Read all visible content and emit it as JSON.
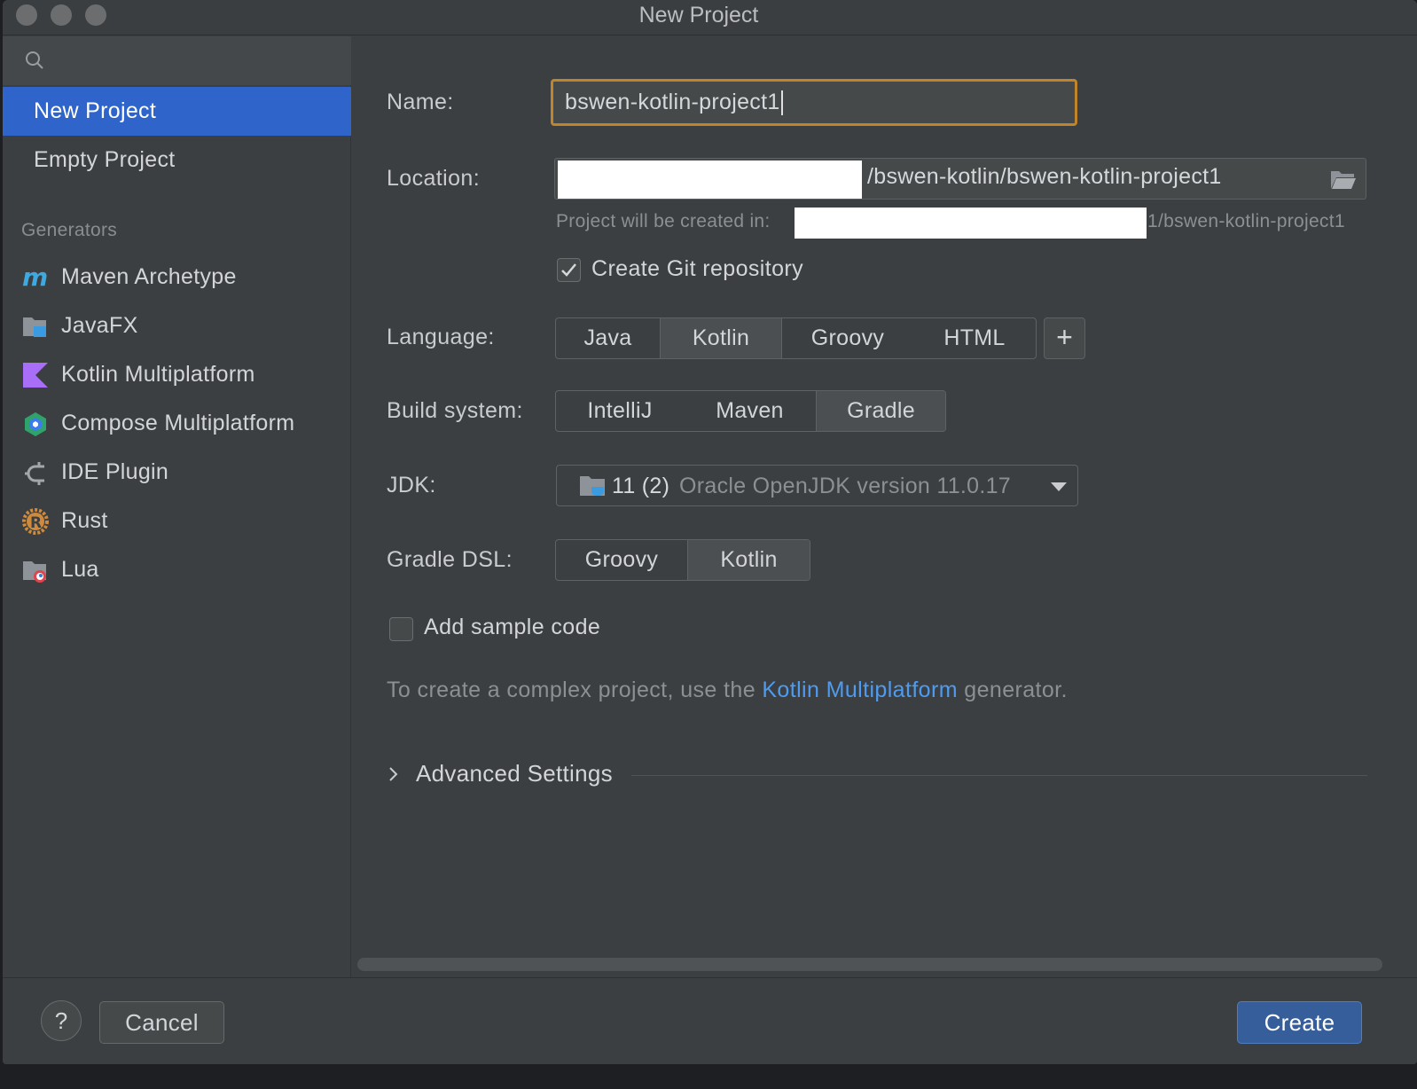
{
  "window": {
    "title": "New Project"
  },
  "sidebar": {
    "search_placeholder": "",
    "project_types": [
      {
        "label": "New Project",
        "selected": true
      },
      {
        "label": "Empty Project",
        "selected": false
      }
    ],
    "generators_header": "Generators",
    "generators": [
      {
        "label": "Maven Archetype",
        "icon": "maven-icon"
      },
      {
        "label": "JavaFX",
        "icon": "javafx-icon"
      },
      {
        "label": "Kotlin Multiplatform",
        "icon": "kotlin-icon"
      },
      {
        "label": "Compose Multiplatform",
        "icon": "compose-icon"
      },
      {
        "label": "IDE Plugin",
        "icon": "plugin-icon"
      },
      {
        "label": "Rust",
        "icon": "rust-icon"
      },
      {
        "label": "Lua",
        "icon": "lua-icon"
      }
    ]
  },
  "form": {
    "name_label": "Name:",
    "name_value": "bswen-kotlin-project1",
    "location_label": "Location:",
    "location_value": "/bswen-kotlin/bswen-kotlin-project1",
    "project_hint_prefix": "Project will be created in:",
    "project_hint_suffix": "1/bswen-kotlin-project1",
    "git_checkbox_label": "Create Git repository",
    "git_checked": true,
    "language_label": "Language:",
    "languages": [
      "Java",
      "Kotlin",
      "Groovy",
      "HTML"
    ],
    "language_selected": "Kotlin",
    "add_language": "+",
    "build_label": "Build system:",
    "build_systems": [
      "IntelliJ",
      "Maven",
      "Gradle"
    ],
    "build_selected": "Gradle",
    "jdk_label": "JDK:",
    "jdk_version": "11 (2)",
    "jdk_description": "Oracle OpenJDK version 11.0.17",
    "gradle_dsl_label": "Gradle DSL:",
    "gradle_dsls": [
      "Groovy",
      "Kotlin"
    ],
    "gradle_dsl_selected": "Kotlin",
    "sample_code_label": "Add sample code",
    "sample_code_checked": false,
    "info_prefix": "To create a complex project, use the ",
    "info_link": "Kotlin Multiplatform",
    "info_suffix": " generator.",
    "advanced_label": "Advanced Settings"
  },
  "footer": {
    "help_label": "?",
    "cancel_label": "Cancel",
    "create_label": "Create"
  },
  "colors": {
    "accent": "#2f65ca",
    "focus_border": "#c0852a",
    "link": "#4e9bf0",
    "create_button": "#365e9a"
  }
}
